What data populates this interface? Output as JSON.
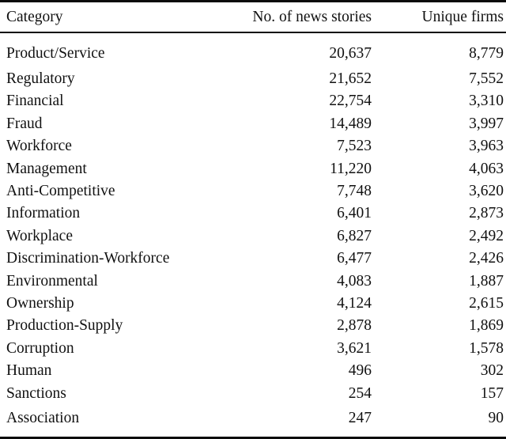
{
  "table": {
    "columns": [
      {
        "key": "category",
        "label": "Category",
        "align": "left"
      },
      {
        "key": "stories",
        "label": "No. of news stories",
        "align": "right"
      },
      {
        "key": "firms",
        "label": "Unique firms",
        "align": "right"
      }
    ],
    "rows": [
      {
        "category": "Product/Service",
        "stories": "20,637",
        "firms": "8,779"
      },
      {
        "category": "Regulatory",
        "stories": "21,652",
        "firms": "7,552"
      },
      {
        "category": "Financial",
        "stories": "22,754",
        "firms": "3,310"
      },
      {
        "category": "Fraud",
        "stories": "14,489",
        "firms": "3,997"
      },
      {
        "category": "Workforce",
        "stories": "7,523",
        "firms": "3,963"
      },
      {
        "category": "Management",
        "stories": "11,220",
        "firms": "4,063"
      },
      {
        "category": "Anti-Competitive",
        "stories": "7,748",
        "firms": "3,620"
      },
      {
        "category": "Information",
        "stories": "6,401",
        "firms": "2,873"
      },
      {
        "category": "Workplace",
        "stories": "6,827",
        "firms": "2,492"
      },
      {
        "category": "Discrimination-Workforce",
        "stories": "6,477",
        "firms": "2,426"
      },
      {
        "category": "Environmental",
        "stories": "4,083",
        "firms": "1,887"
      },
      {
        "category": "Ownership",
        "stories": "4,124",
        "firms": "2,615"
      },
      {
        "category": "Production-Supply",
        "stories": "2,878",
        "firms": "1,869"
      },
      {
        "category": "Corruption",
        "stories": "3,621",
        "firms": "1,578"
      },
      {
        "category": "Human",
        "stories": "496",
        "firms": "302"
      },
      {
        "category": "Sanctions",
        "stories": "254",
        "firms": "157"
      },
      {
        "category": "Association",
        "stories": "247",
        "firms": "90"
      }
    ]
  }
}
